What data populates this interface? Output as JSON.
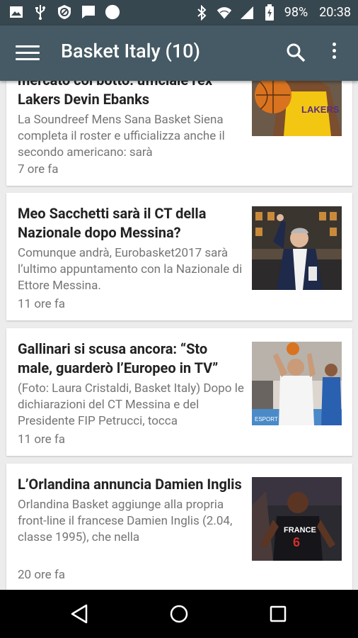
{
  "status_bar": {
    "battery": "98%",
    "time": "20:38",
    "icons": [
      "image-icon",
      "usb-icon",
      "blocked-icon",
      "message-icon",
      "circle-icon",
      "bluetooth-icon",
      "wifi-icon",
      "signal-icon",
      "battery-icon"
    ]
  },
  "app_bar": {
    "title": "Basket Italy (10)",
    "icons": [
      "menu-icon",
      "search-icon",
      "more-vert-icon"
    ]
  },
  "articles": [
    {
      "headline_clipped": "mercato col botto: ufficiale l'ex",
      "headline": "Lakers Devin Ebanks",
      "snippet": "La Soundreef Mens Sana Basket Siena completa il roster e ufficializza anche il secondo americano: sarà",
      "time": "7 ore fa"
    },
    {
      "headline": "Meo Sacchetti sarà il CT della Nazionale dopo Messina?",
      "snippet": "Comunque andrà, Eurobasket2017 sarà l’ultimo appuntamento con la Nazionale di Ettore Messina.",
      "time": "11 ore fa"
    },
    {
      "headline": "Gallinari si scusa ancora: “Sto male, guarderò l’Europeo in TV”",
      "snippet": "(Foto: Laura Cristaldi, Basket Italy) Dopo le dichiarazioni del CT Messina e del Presidente FIP Petrucci, tocca",
      "time": "11 ore fa"
    },
    {
      "headline": "L’Orlandina annuncia Damien Inglis",
      "snippet": "Orlandina Basket  aggiunge alla propria front-line il francese  Damien Inglis  (2.04, classe 1995), che nella",
      "time": "20 ore fa"
    }
  ],
  "thumb_text": {
    "jersey_lakers": "LAKERS",
    "jersey_france": "FRANCE",
    "jersey_number": "6",
    "sign": "ESPORT"
  },
  "nav_bar": {
    "icons": [
      "back-icon",
      "home-icon",
      "recents-icon"
    ]
  },
  "colors": {
    "status_bar": "#37474f",
    "app_bar": "#455a64",
    "background": "#ececec"
  }
}
